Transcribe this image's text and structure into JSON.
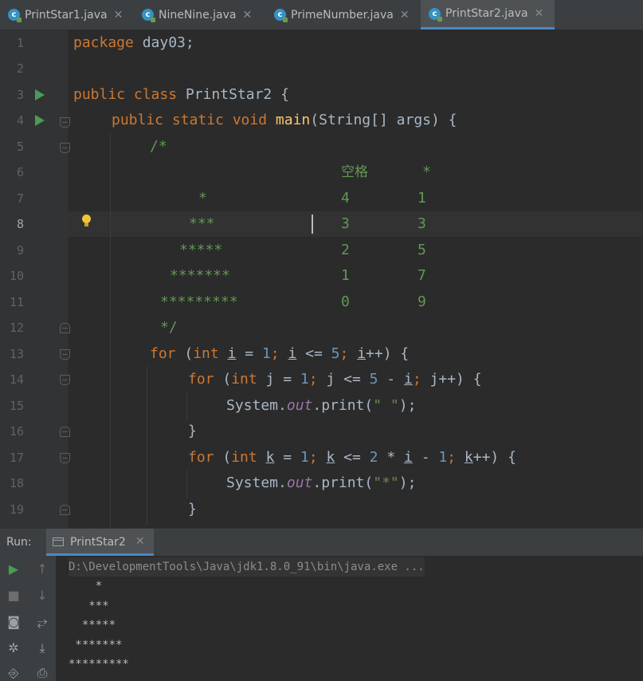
{
  "tabs": [
    {
      "label": "PrintStar1.java",
      "active": false
    },
    {
      "label": "NineNine.java",
      "active": false
    },
    {
      "label": "PrimeNumber.java",
      "active": false
    },
    {
      "label": "PrintStar2.java",
      "active": true
    }
  ],
  "line_numbers": [
    "1",
    "2",
    "3",
    "4",
    "5",
    "6",
    "7",
    "8",
    "9",
    "10",
    "11",
    "12",
    "13",
    "14",
    "15",
    "16",
    "17",
    "18",
    "19"
  ],
  "current_line": "8",
  "code": {
    "l1": {
      "kw": "package",
      "rest": " day03;"
    },
    "l3": {
      "kw": "public class",
      "rest": " PrintStar2 {"
    },
    "l4": {
      "kw": "public static void",
      "fn": "main",
      "rest": "(String[] args) {"
    },
    "l5": "/*",
    "l6": {
      "a": "空格",
      "b": "*"
    },
    "l7": {
      "stars": "*",
      "a": "4",
      "b": "1"
    },
    "l8": {
      "stars": "***",
      "a": "3",
      "b": "3"
    },
    "l9": {
      "stars": "*****",
      "a": "2",
      "b": "5"
    },
    "l10": {
      "stars": "*******",
      "a": "1",
      "b": "7"
    },
    "l11": {
      "stars": "*********",
      "a": "0",
      "b": "9"
    },
    "l12": "*/",
    "l13": {
      "for": "for",
      "p1": " (",
      "int": "int",
      "i1": "i",
      "eq": " = ",
      "n1": "1",
      "sc1": "; ",
      "i2": "i",
      "le": " <= ",
      "n5": "5",
      "sc2": "; ",
      "i3": "i",
      "inc": "++) {"
    },
    "l14": {
      "for": "for",
      "p1": " (",
      "int": "int",
      "rest1": " j = ",
      "n1": "1",
      "sc1": "; ",
      "rest2": "j <= ",
      "n5": "5",
      "rest3": " - ",
      "i": "i",
      "sc2": "; ",
      "rest4": "j++) {"
    },
    "l15": {
      "a": "System.",
      "out": "out",
      "b": ".print(",
      "s": "\" \"",
      "c": ");"
    },
    "l16": "}",
    "l17": {
      "for": "for",
      "p1": " (",
      "int": "int",
      "k1": "k",
      "eq": " = ",
      "n1": "1",
      "sc1": "; ",
      "k2": "k",
      "le": " <= ",
      "n2": "2",
      "mul": " * ",
      "i": "i",
      "minus": " - ",
      "n1b": "1",
      "sc2": "; ",
      "k3": "k",
      "inc": "++) {"
    },
    "l18": {
      "a": "System.",
      "out": "out",
      "b": ".print(",
      "s": "\"*\"",
      "c": ");"
    },
    "l19": "}"
  },
  "run": {
    "label": "Run:",
    "tab": "PrintStar2",
    "path": "D:\\DevelopmentTools\\Java\\jdk1.8.0_91\\bin\\java.exe ...",
    "output": [
      "    *",
      "   ***",
      "  *****",
      " *******",
      "*********"
    ]
  },
  "colors": {
    "keyword": "#cc7832",
    "number": "#6897bb",
    "string": "#6a8759",
    "method": "#ffc66d",
    "comment": "#629755",
    "accent": "#4a88c7"
  }
}
